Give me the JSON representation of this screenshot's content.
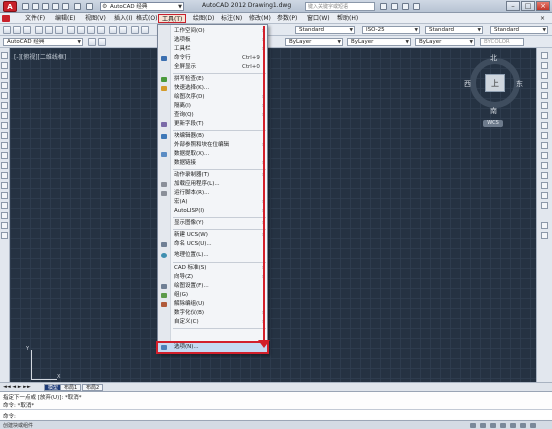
{
  "title_bar": {
    "workspace": "AutoCAD 经典",
    "app_title": "AutoCAD 2012    Drawing1.dwg",
    "search_placeholder": "键入关键字或短语",
    "minimize": "–",
    "maximize": "□",
    "close": "×",
    "logo": "A"
  },
  "menu_bar": [
    "文件(F)",
    "编辑(E)",
    "视图(V)",
    "插入(I)",
    "格式(O)",
    "工具(T)",
    "绘图(D)",
    "标注(N)",
    "修改(M)",
    "参数(P)",
    "窗口(W)",
    "帮助(H)"
  ],
  "toolbar2": {
    "text_style": "Standard",
    "dim_style": "ISO-25",
    "table_style": "Standard",
    "multileader_style": "Standard"
  },
  "toolbar3": {
    "workspace": "AutoCAD 经典",
    "color": "ByLayer",
    "linetype": "ByLayer",
    "lineweight": "ByLayer",
    "plot_style": "BYCOLOR"
  },
  "viewport": {
    "label": "[-][俯视][二维线框]"
  },
  "viewcube": {
    "top": "上",
    "north": "北",
    "south": "南",
    "east": "东",
    "west": "西",
    "wcs": "WCS"
  },
  "ucs": {
    "x": "X",
    "y": "Y"
  },
  "layout_tabs": [
    "模型",
    "布局1",
    "布局2"
  ],
  "command": {
    "line1": "指定下一点或 [放弃(U)]: *取消*",
    "line2": "命令: *取消*",
    "prompt": "命令:"
  },
  "status_bar": {
    "text": "创建块或组件"
  },
  "tools_menu": {
    "items": [
      {
        "label": "工作空间(O)",
        "shortcut": "",
        "submenu": true
      },
      {
        "label": "选项板",
        "shortcut": "",
        "submenu": true
      },
      {
        "label": "工具栏",
        "shortcut": "",
        "submenu": true
      },
      {
        "label": "命令行",
        "shortcut": "Ctrl+9",
        "submenu": false
      },
      {
        "label": "全屏显示",
        "shortcut": "Ctrl+0",
        "submenu": false
      },
      {
        "label": "拼写检查(E)",
        "shortcut": "",
        "submenu": false
      },
      {
        "label": "快速选择(K)...",
        "shortcut": "",
        "submenu": false
      },
      {
        "label": "绘图次序(D)",
        "shortcut": "",
        "submenu": true
      },
      {
        "label": "隔离(I)",
        "shortcut": "",
        "submenu": true
      },
      {
        "label": "查询(Q)",
        "shortcut": "",
        "submenu": true
      },
      {
        "label": "更新字段(T)",
        "shortcut": "",
        "submenu": false
      },
      {
        "label": "块编辑器(B)",
        "shortcut": "",
        "submenu": false
      },
      {
        "label": "外部参照和块在位编辑",
        "shortcut": "",
        "submenu": true
      },
      {
        "label": "数据提取(X)...",
        "shortcut": "",
        "submenu": false
      },
      {
        "label": "数据链接",
        "shortcut": "",
        "submenu": true
      },
      {
        "label": "动作录制器(T)",
        "shortcut": "",
        "submenu": true
      },
      {
        "label": "加载应用程序(L)...",
        "shortcut": "",
        "submenu": false
      },
      {
        "label": "运行脚本(R)...",
        "shortcut": "",
        "submenu": false
      },
      {
        "label": "宏(A)",
        "shortcut": "",
        "submenu": true
      },
      {
        "label": "AutoLISP(I)",
        "shortcut": "",
        "submenu": true
      },
      {
        "label": "显示图像(Y)",
        "shortcut": "",
        "submenu": true
      },
      {
        "label": "新建 UCS(W)",
        "shortcut": "",
        "submenu": true
      },
      {
        "label": "命名 UCS(U)...",
        "shortcut": "",
        "submenu": false
      },
      {
        "label": "地理位置(L)...",
        "shortcut": "",
        "submenu": false
      },
      {
        "label": "CAD 标准(S)",
        "shortcut": "",
        "submenu": true
      },
      {
        "label": "向导(Z)",
        "shortcut": "",
        "submenu": true
      },
      {
        "label": "绘图设置(F)...",
        "shortcut": "",
        "submenu": false
      },
      {
        "label": "组(G)",
        "shortcut": "",
        "submenu": false
      },
      {
        "label": "解除编组(U)",
        "shortcut": "",
        "submenu": false
      },
      {
        "label": "数字化仪(B)",
        "shortcut": "",
        "submenu": true
      },
      {
        "label": "自定义(C)",
        "shortcut": "",
        "submenu": true
      },
      {
        "label": "选项(N)...",
        "shortcut": "",
        "submenu": false
      }
    ],
    "submenu_arrow": "›"
  }
}
